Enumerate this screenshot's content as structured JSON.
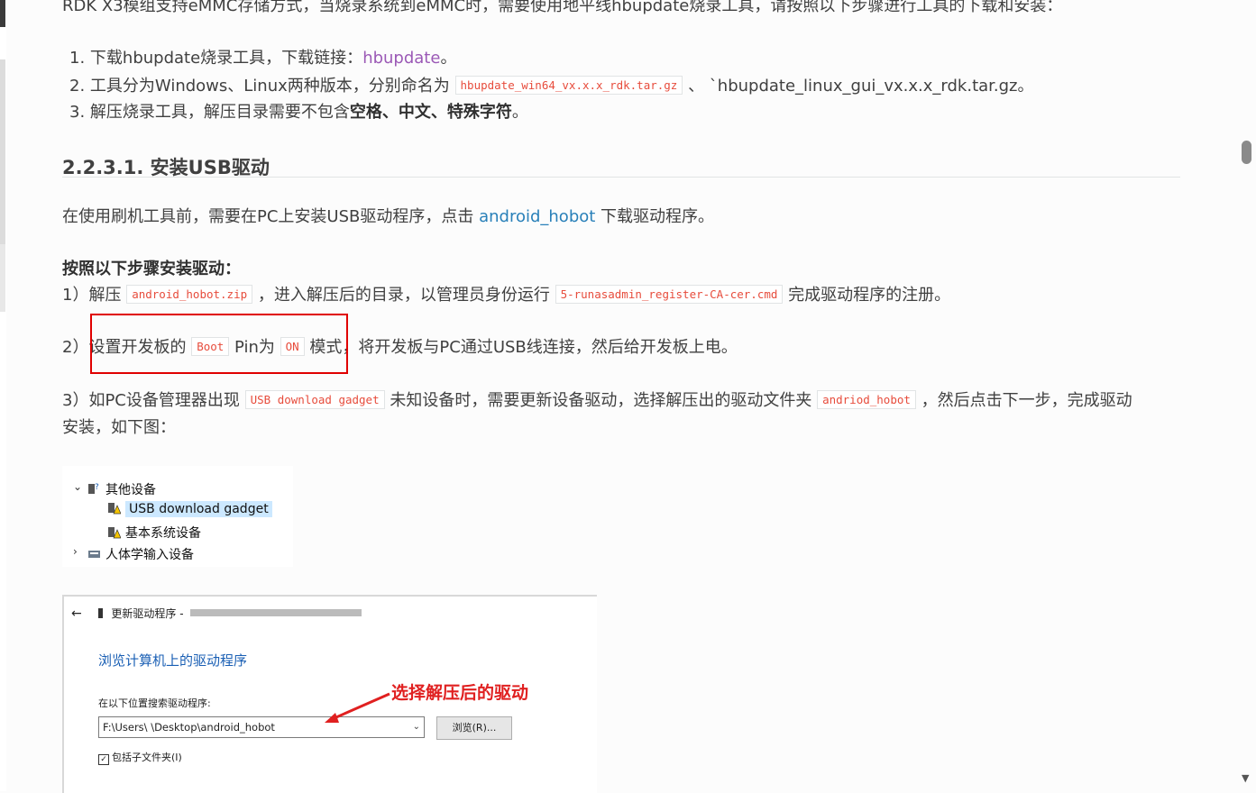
{
  "intro_line": "RDK X3模组支持eMMC存储方式，当烧录系统到eMMC时，需要使用地平线hbupdate烧录工具，请按照以下步骤进行工具的下载和安装：",
  "steps_list": [
    {
      "num": "1.",
      "text": "下载hbupdate烧录工具，下载链接：",
      "link": "hbupdate",
      "tail": "。"
    },
    {
      "num": "2.",
      "text": "工具分为Windows、Linux两种版本，分别命名为",
      "code": "hbupdate_win64_vx.x.x_rdk.tar.gz",
      "tail": "、 `hbupdate_linux_gui_vx.x.x_rdk.tar.gz。"
    },
    {
      "num": "3.",
      "text": "解压烧录工具，解压目录需要不包含",
      "bold": "空格、中文、特殊字符",
      "tail": "。"
    }
  ],
  "section_heading": "2.2.3.1. 安装USB驱动",
  "usb_para": {
    "pre": "在使用刷机工具前，需要在PC上安装USB驱动程序，点击 ",
    "link": "android_hobot",
    "post": " 下载驱动程序。"
  },
  "steps_title": "按照以下步骤安装驱动：",
  "step1": {
    "pre": "1）解压 ",
    "code1": "android_hobot.zip",
    "mid": " ，进入解压后的目录，以管理员身份运行 ",
    "code2": "5-runasadmin_register-CA-cer.cmd",
    "post": " 完成驱动程序的注册。"
  },
  "step2": {
    "pre": "2）设置开发板的 ",
    "code1": "Boot",
    "mid": " Pin为 ",
    "code2": "ON",
    "post": " 模式，将开发板与PC通过USB线连接，然后给开发板上电。"
  },
  "step3": {
    "pre": "3）如PC设备管理器出现 ",
    "code1": "USB download gadget",
    "mid": " 未知设备时，需要更新设备驱动，选择解压出的驱动文件夹 ",
    "code2": "andriod_hobot",
    "post": " ，然后点击下一步，完成驱动",
    "line2": "安装，如下图："
  },
  "device_manager": {
    "rows": [
      "其他设备",
      "USB download gadget",
      "基本系统设备",
      "人体学输入设备"
    ]
  },
  "driver_dialog": {
    "title": "更新驱动程序 -",
    "heading": "浏览计算机上的驱动程序",
    "search_label": "在以下位置搜索驱动程序:",
    "path": "F:\\Users\\         \\Desktop\\android_hobot",
    "browse": "浏览(R)...",
    "subfolders": "包括子文件夹(I)",
    "annotation": "选择解压后的驱动"
  },
  "colors": {
    "link": "#2980b9",
    "visited_link": "#9b59b6",
    "code": "#e74c3c",
    "highlight_box": "#e00000",
    "annotation": "#e02020"
  }
}
